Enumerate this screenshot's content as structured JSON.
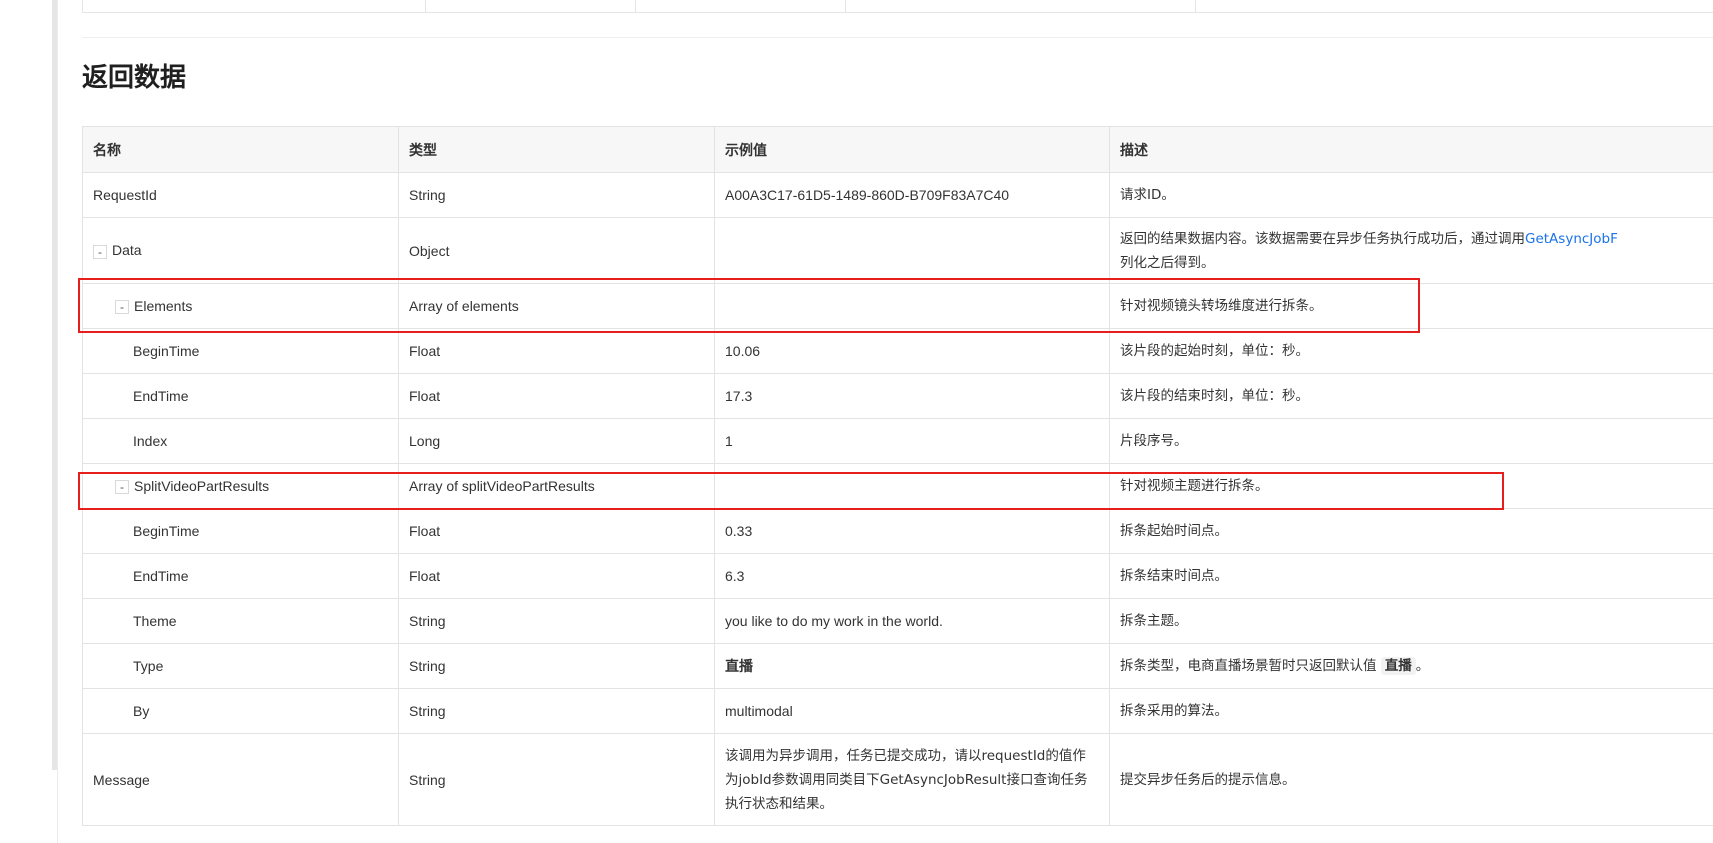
{
  "section": {
    "title": "返回数据"
  },
  "table": {
    "headers": {
      "name": "名称",
      "type": "类型",
      "example": "示例值",
      "desc": "描述"
    },
    "rows": [
      {
        "name": "RequestId",
        "type": "String",
        "example": "A00A3C17-61D5-1489-860D-B709F83A7C40",
        "desc": "请求ID。"
      },
      {
        "toggle": "-",
        "name": "Data",
        "type": "Object",
        "example": "",
        "desc_before": "返回的结果数据内容。该数据需要在异步任务执行成功后，通过调用",
        "desc_link": "GetAsyncJobF",
        "desc_after": "列化之后得到。"
      },
      {
        "toggle": "-",
        "name": "Elements",
        "type": "Array of elements",
        "example": "",
        "desc": "针对视频镜头转场维度进行拆条。"
      },
      {
        "name": "BeginTime",
        "type": "Float",
        "example": "10.06",
        "desc": "该片段的起始时刻，单位：秒。"
      },
      {
        "name": "EndTime",
        "type": "Float",
        "example": "17.3",
        "desc": "该片段的结束时刻，单位：秒。"
      },
      {
        "name": "Index",
        "type": "Long",
        "example": "1",
        "desc": "片段序号。"
      },
      {
        "toggle": "-",
        "name": "SplitVideoPartResults",
        "type": "Array of splitVideoPartResults",
        "example": "",
        "desc": "针对视频主题进行拆条。"
      },
      {
        "name": "BeginTime",
        "type": "Float",
        "example": "0.33",
        "desc": "拆条起始时间点。"
      },
      {
        "name": "EndTime",
        "type": "Float",
        "example": "6.3",
        "desc": "拆条结束时间点。"
      },
      {
        "name": "Theme",
        "type": "String",
        "example": "you like to do my work in the world.",
        "desc": "拆条主题。"
      },
      {
        "name": "Type",
        "type": "String",
        "example": "直播",
        "desc_before": "拆条类型，电商直播场景暂时只返回默认值",
        "desc_code": "直播",
        "desc_after": "。"
      },
      {
        "name": "By",
        "type": "String",
        "example": "multimodal",
        "desc": "拆条采用的算法。"
      },
      {
        "name": "Message",
        "type": "String",
        "example": "该调用为异步调用，任务已提交成功，请以requestId的值作为jobId参数调用同类目下GetAsyncJobResult接口查询任务执行状态和结果。",
        "desc": "提交异步任务后的提示信息。"
      }
    ]
  },
  "colors": {
    "highlight": "#e61e1e",
    "link": "#1a73e8",
    "header_bg": "#f7f7f7"
  }
}
